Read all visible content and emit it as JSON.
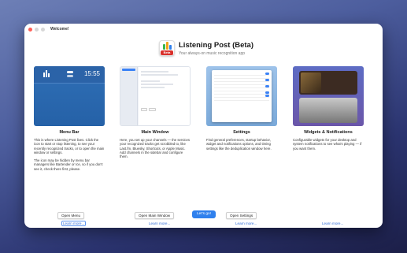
{
  "window": {
    "title": "Welcome!"
  },
  "header": {
    "app_title": "Listening Post (Beta)",
    "app_subtitle": "Your always-on music recognition app",
    "icon_badge": "Beta"
  },
  "columns": [
    {
      "title": "Menu Bar",
      "thumb_clock": "15:55",
      "desc1": "This is where Listening Post lives. Click the icon to start or stop listening, to see your recently recognized tracks, or to open the main window or settings.",
      "desc2": "The icon may be hidden by menu bar managers like Bartender or Ice, so if you don't see it, check there first, please.",
      "button": "Open Menu",
      "link": "Learn more..."
    },
    {
      "title": "Main Window",
      "desc1": "Here, you set up your channels — the services your recognized tracks get scrobbled to, like Last.fm, Bluesky, Shortcuts, or Apple Music. Add channels in the sidebar and configure them.",
      "button": "Open Main Window",
      "link": "Learn more..."
    },
    {
      "title": "Settings",
      "desc1": "Find general preferences, startup behavior, widget and notifications options, and timing settings like the deduplication window here.",
      "button": "Open Settings",
      "link": "Learn more..."
    },
    {
      "title": "Widgets & Notifications",
      "desc1": "Configurable widgets for your desktop and system notifications to see what's playing — if you want them.",
      "link": "Learn more..."
    }
  ],
  "footer": {
    "go_button": "Let's go!"
  },
  "colors": {
    "accent": "#2f80ed",
    "link": "#2f6bd6"
  }
}
